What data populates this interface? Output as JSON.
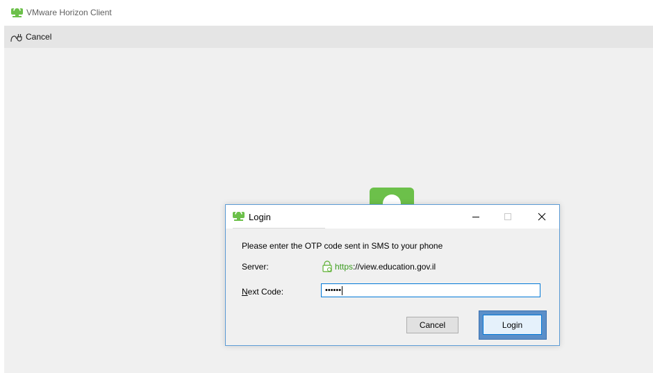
{
  "window": {
    "title": "VMware Horizon Client",
    "app_icon": "vmware-horizon-icon",
    "brand_color": "#6cc04a"
  },
  "toolbar": {
    "cancel_label": "Cancel",
    "cancel_icon": "plug-icon"
  },
  "dialog": {
    "title": "Login",
    "title_icon": "vmware-horizon-icon",
    "controls": {
      "minimize": "minimize-icon",
      "maximize": "maximize-icon",
      "close": "close-icon"
    },
    "prompt": "Please enter the OTP code sent in SMS to your phone",
    "server_label": "Server:",
    "server_scheme": "https",
    "server_rest": "://view.education.gov.il",
    "server_icon": "lock-icon",
    "next_code_label_key": "N",
    "next_code_label_rest": "ext Code:",
    "next_code_value": "••••••",
    "cancel_button": "Cancel",
    "login_button": "Login",
    "focus_color": "#0078d7"
  }
}
